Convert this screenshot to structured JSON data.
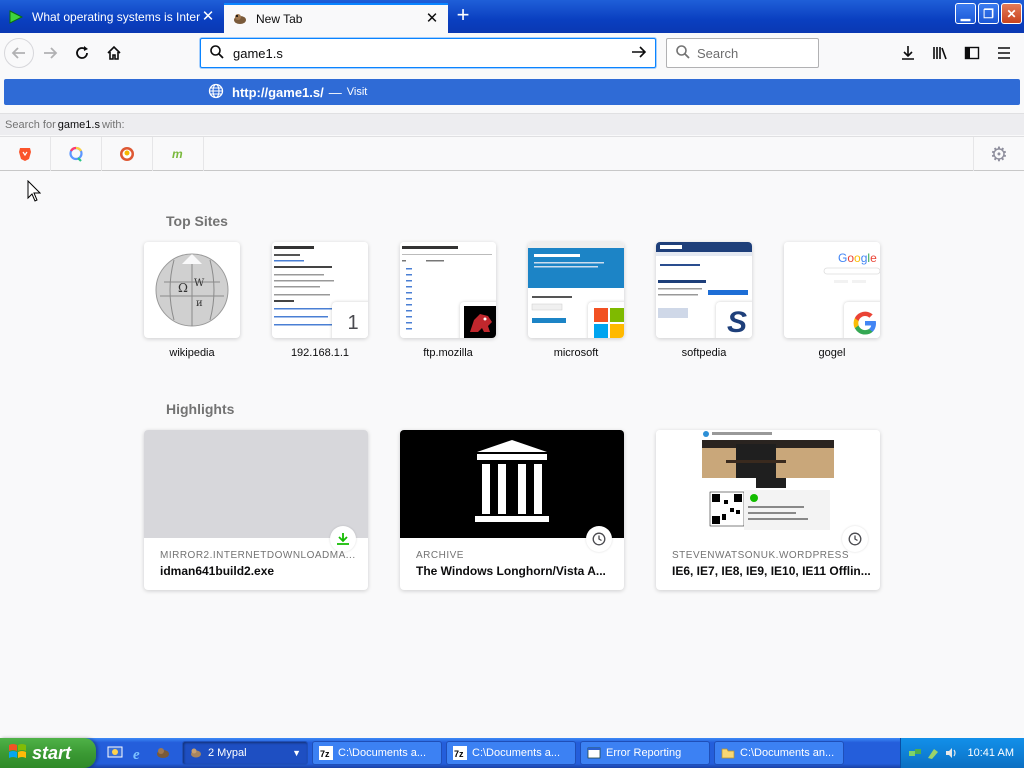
{
  "browser": {
    "tabs": [
      {
        "title": "What operating systems is Interne",
        "active": false
      },
      {
        "title": "New Tab",
        "active": true
      }
    ],
    "new_tab_label": "+"
  },
  "navbar": {
    "url_value": "game1.s",
    "search_placeholder": "Search"
  },
  "dropdown": {
    "suggestion_url": "http://game1.s/",
    "suggestion_separator": "—",
    "suggestion_action": "Visit",
    "search_with_prefix": "Search for",
    "search_with_query": "game1.s",
    "search_with_suffix": "with:"
  },
  "newtab": {
    "top_sites_title": "Top Sites",
    "top_sites": [
      {
        "label": "wikipedia"
      },
      {
        "label": "192.168.1.1",
        "badge": "1"
      },
      {
        "label": "ftp.mozilla"
      },
      {
        "label": "microsoft"
      },
      {
        "label": "softpedia"
      },
      {
        "label": "gogel"
      }
    ],
    "highlights_title": "Highlights",
    "highlights": [
      {
        "host": "MIRROR2.INTERNETDOWNLOADMA...",
        "title": "idman641build2.exe"
      },
      {
        "host": "ARCHIVE",
        "title": "The Windows Longhorn/Vista A..."
      },
      {
        "host": "STEVENWATSONUK.WORDPRESS",
        "title": "IE6, IE7, IE8, IE9, IE10, IE11 Offlin..."
      }
    ]
  },
  "taskbar": {
    "start_label": "start",
    "tasks": [
      {
        "label": "2 Mypal",
        "active": true
      },
      {
        "label": "C:\\Documents a..."
      },
      {
        "label": "C:\\Documents a..."
      },
      {
        "label": "Error Reporting"
      },
      {
        "label": "C:\\Documents an..."
      }
    ],
    "clock": "10:41 AM"
  },
  "colors": {
    "accent": "#0a84ff",
    "suggestion_bg": "#2f6bd6",
    "xp_blue": "#245edb",
    "start_green": "#3b9a34"
  }
}
